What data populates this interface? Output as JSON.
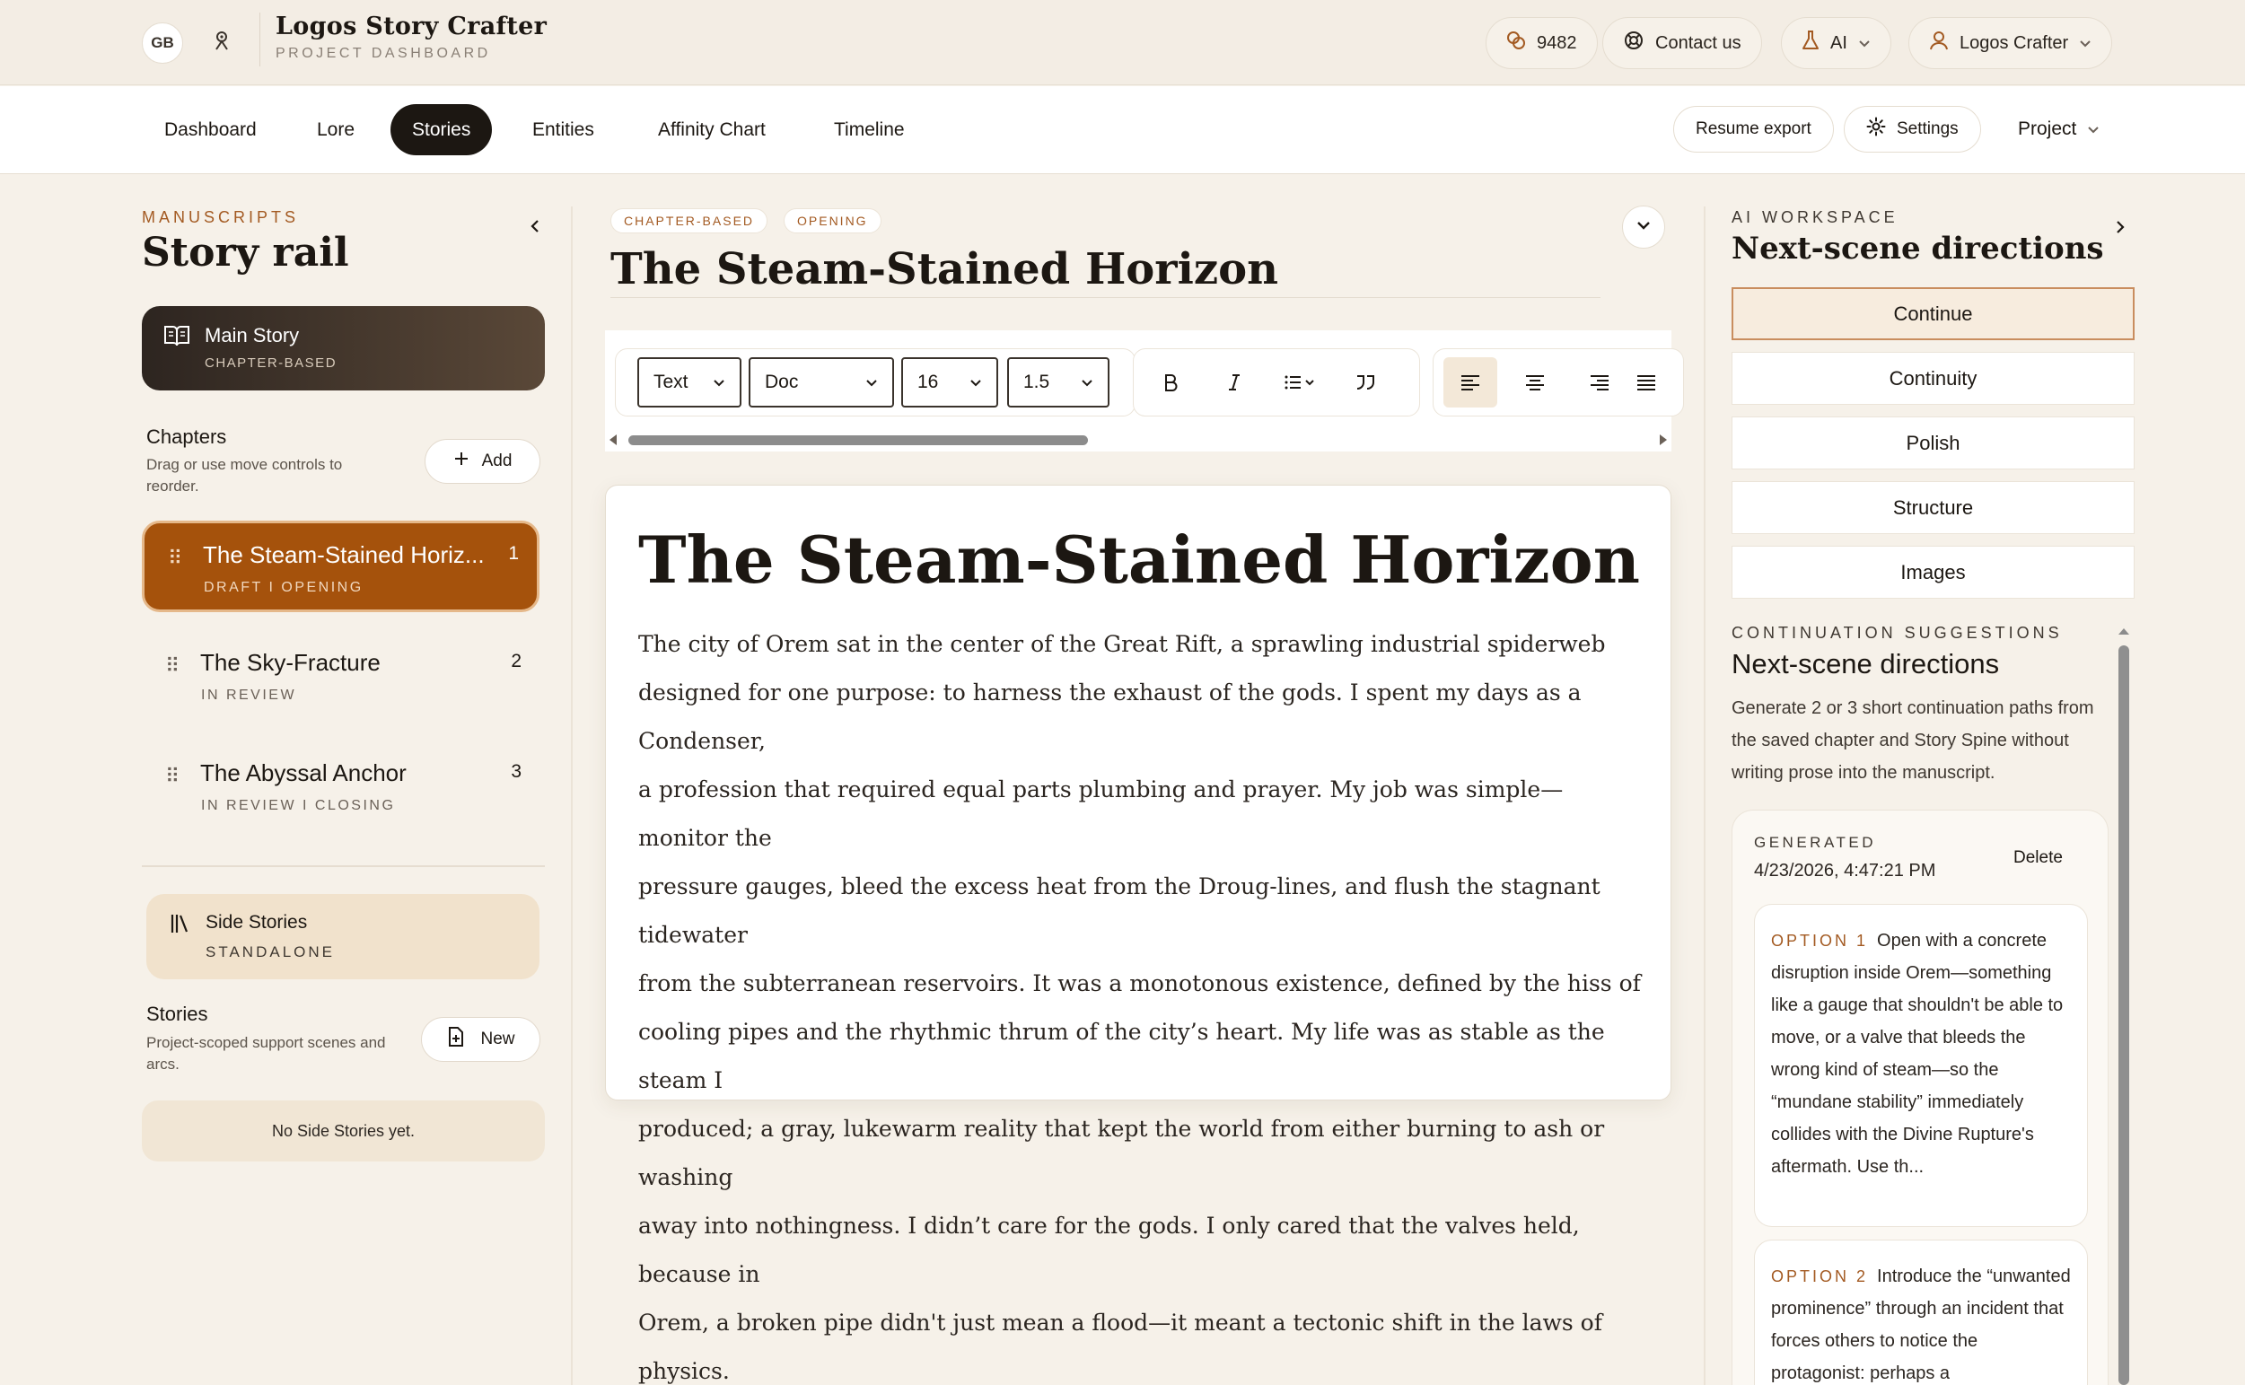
{
  "header": {
    "user_initials": "GB",
    "brand_title": "Logos Story Crafter",
    "brand_subtitle": "PROJECT DASHBOARD",
    "credits": "9482",
    "contact_label": "Contact us",
    "ai_label": "AI",
    "account_label": "Logos Crafter"
  },
  "nav": {
    "tabs": [
      {
        "label": "Dashboard"
      },
      {
        "label": "Lore"
      },
      {
        "label": "Stories",
        "active": true
      },
      {
        "label": "Entities"
      },
      {
        "label": "Affinity Chart"
      },
      {
        "label": "Timeline"
      }
    ],
    "resume_export": "Resume export",
    "settings": "Settings",
    "project": "Project"
  },
  "rail": {
    "kicker": "MANUSCRIPTS",
    "title": "Story rail",
    "main_story": {
      "title": "Main Story",
      "subtitle": "CHAPTER-BASED"
    },
    "chapters_heading": "Chapters",
    "chapters_desc": "Drag or use move controls to reorder.",
    "add_label": "Add",
    "chapters": [
      {
        "title": "The Steam-Stained Horiz...",
        "number": "1",
        "status": "DRAFT I OPENING",
        "active": true
      },
      {
        "title": "The Sky-Fracture",
        "number": "2",
        "status": "IN REVIEW"
      },
      {
        "title": "The Abyssal Anchor",
        "number": "3",
        "status": "IN REVIEW I CLOSING"
      }
    ],
    "side_stories": {
      "title": "Side Stories",
      "subtitle": "STANDALONE"
    },
    "stories_heading": "Stories",
    "stories_desc": "Project-scoped support scenes and arcs.",
    "new_label": "New",
    "empty_text": "No Side Stories yet."
  },
  "editor": {
    "tags": [
      "CHAPTER-BASED",
      "OPENING"
    ],
    "chapter_title": "The Steam-Stained Horizon",
    "toolbar": {
      "style_select": "Text",
      "font_select": "Doc",
      "size_select": "16",
      "line_height_select": "1.5"
    },
    "doc_heading": "The Steam-Stained Horizon",
    "body_lines": [
      "The city of Orem sat in the center of the Great Rift, a sprawling industrial spiderweb",
      "designed for one purpose: to harness the exhaust of the gods. I spent my days as a Condenser,",
      "a profession that required equal parts plumbing and prayer. My job was simple—monitor the",
      "pressure gauges, bleed the excess heat from the Droug-lines, and flush the stagnant tidewater",
      "from the subterranean reservoirs. It was a monotonous existence, defined by the hiss of",
      "cooling pipes and the rhythmic thrum of the city’s heart. My life was as stable as the steam I",
      "produced; a gray, lukewarm reality that kept the world from either burning to ash or washing",
      "away into nothingness. I didn’t care for the gods. I only cared that the valves held, because in",
      "Orem, a broken pipe didn't just mean a flood—it meant a tectonic shift in the laws of physics."
    ]
  },
  "ai": {
    "kicker": "AI WORKSPACE",
    "title": "Next-scene directions",
    "actions": [
      {
        "label": "Continue",
        "active": true
      },
      {
        "label": "Continuity"
      },
      {
        "label": "Polish"
      },
      {
        "label": "Structure"
      },
      {
        "label": "Images"
      }
    ],
    "suggest_kicker": "CONTINUATION SUGGESTIONS",
    "suggest_title": "Next-scene directions",
    "suggest_desc": "Generate 2 or 3 short continuation paths from the saved chapter and Story Spine without writing prose into the manuscript.",
    "generated_kicker": "GENERATED",
    "generated_date": "4/23/2026, 4:47:21 PM",
    "delete_label": "Delete",
    "options": [
      {
        "label": "OPTION 1",
        "text": "Open with a concrete disruption inside Orem—something like a gauge that shouldn't be able to move, or a valve that bleeds the wrong kind of steam—so the “mundane stability” immediately collides with the Divine Rupture's aftermath. Use th..."
      },
      {
        "label": "OPTION 2",
        "text": "Introduce the “unwanted prominence” through an incident that forces others to notice the protagonist: perhaps a"
      }
    ]
  },
  "colors": {
    "accent": "#a35a22",
    "active_chapter": "#a5520c",
    "nav_active": "#1c1712",
    "background": "#f6f1e9"
  }
}
